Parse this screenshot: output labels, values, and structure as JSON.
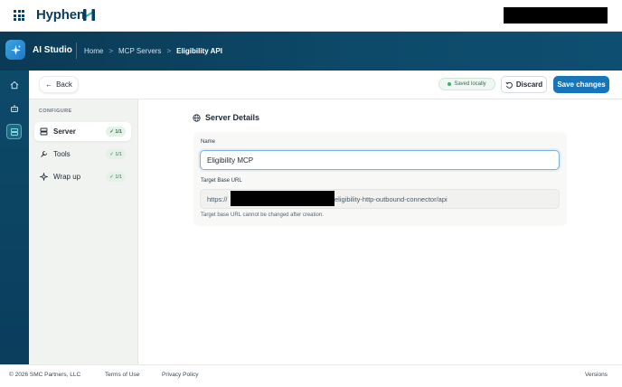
{
  "app": {
    "brand": "Hyphen",
    "studio_title": "AI Studio"
  },
  "breadcrumb": {
    "items": [
      "Home",
      "MCP Servers",
      "Eligibility API"
    ],
    "separator": ">"
  },
  "actions": {
    "back_label": "Back",
    "saved_badge": "Saved locally",
    "discard_label": "Discard",
    "save_label": "Save changes"
  },
  "sidebar": {
    "heading": "CONFIGURE",
    "items": [
      {
        "label": "Server",
        "badge": "1/1",
        "icon": "server-icon",
        "active": true
      },
      {
        "label": "Tools",
        "badge": "1/1",
        "icon": "wrench-icon",
        "active": false
      },
      {
        "label": "Wrap up",
        "badge": "1/1",
        "icon": "sparkle-icon",
        "active": false
      }
    ]
  },
  "form": {
    "section_title": "Server Details",
    "name_label": "Name",
    "name_value": "Eligibility MCP",
    "url_label": "Target Base URL",
    "url_prefix": "https://",
    "url_suffix": "eligibility-http-outbound-connector/api",
    "url_helper": "Target base URL cannot be changed after creation."
  },
  "footer": {
    "copyright": "© 2026 SMC Partners, LLC",
    "terms": "Terms of Use",
    "privacy": "Privacy Policy",
    "versions": "Versions"
  },
  "colors": {
    "header_bg": "#0b3d5c",
    "primary": "#1775b9",
    "success": "#3fae6e"
  }
}
